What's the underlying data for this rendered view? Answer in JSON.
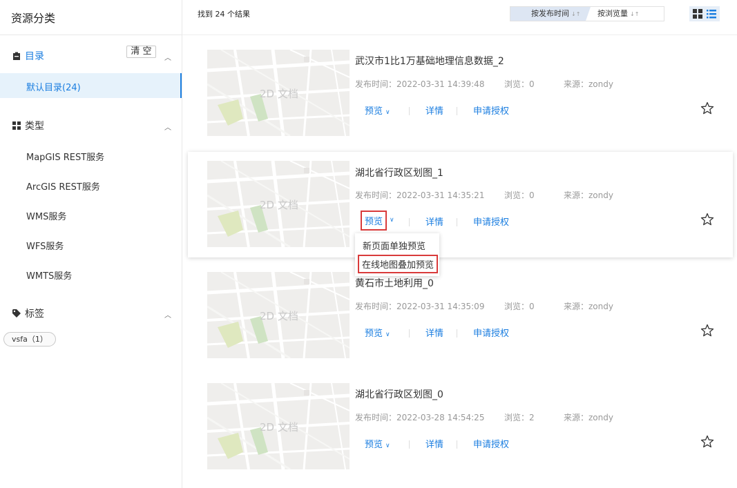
{
  "sidebar": {
    "title": "资源分类",
    "catalog": {
      "label": "目录",
      "clear": "清 空",
      "selected": "默认目录(24)"
    },
    "types": {
      "label": "类型",
      "items": [
        "MapGIS REST服务",
        "ArcGIS REST服务",
        "WMS服务",
        "WFS服务",
        "WMTS服务"
      ]
    },
    "tags": {
      "label": "标签",
      "chip": "vsfa（1）"
    }
  },
  "toolbar": {
    "result_count": "找到 24 个结果",
    "sort_publish": "按发布时间",
    "sort_views": "按浏览量"
  },
  "thumb_label": "2D 文档",
  "actions": {
    "preview": "预览",
    "details": "详情",
    "apply": "申请授权"
  },
  "items": [
    {
      "title": "武汉市1比1万基础地理信息数据_2",
      "publish": "发布时间：2022-03-31 14:39:48",
      "views": "浏览：0",
      "source": "来源：zondy"
    },
    {
      "title": "湖北省行政区划图_1",
      "publish": "发布时间：2022-03-31 14:35:21",
      "views": "浏览：0",
      "source": "来源：zondy"
    },
    {
      "title": "黄石市土地利用_0",
      "publish": "发布时间：2022-03-31 14:35:09",
      "views": "浏览：0",
      "source": "来源：zondy"
    },
    {
      "title": "湖北省行政区划图_0",
      "publish": "发布时间：2022-03-28 14:54:25",
      "views": "浏览：2",
      "source": "来源：zondy"
    }
  ],
  "preview_menu": {
    "new_page": "新页面单独预览",
    "overlay": "在线地图叠加预览"
  },
  "colors": {
    "accent": "#1b7ee0",
    "highlight": "#d93a3a",
    "selected_bg": "#e6f2fb"
  }
}
